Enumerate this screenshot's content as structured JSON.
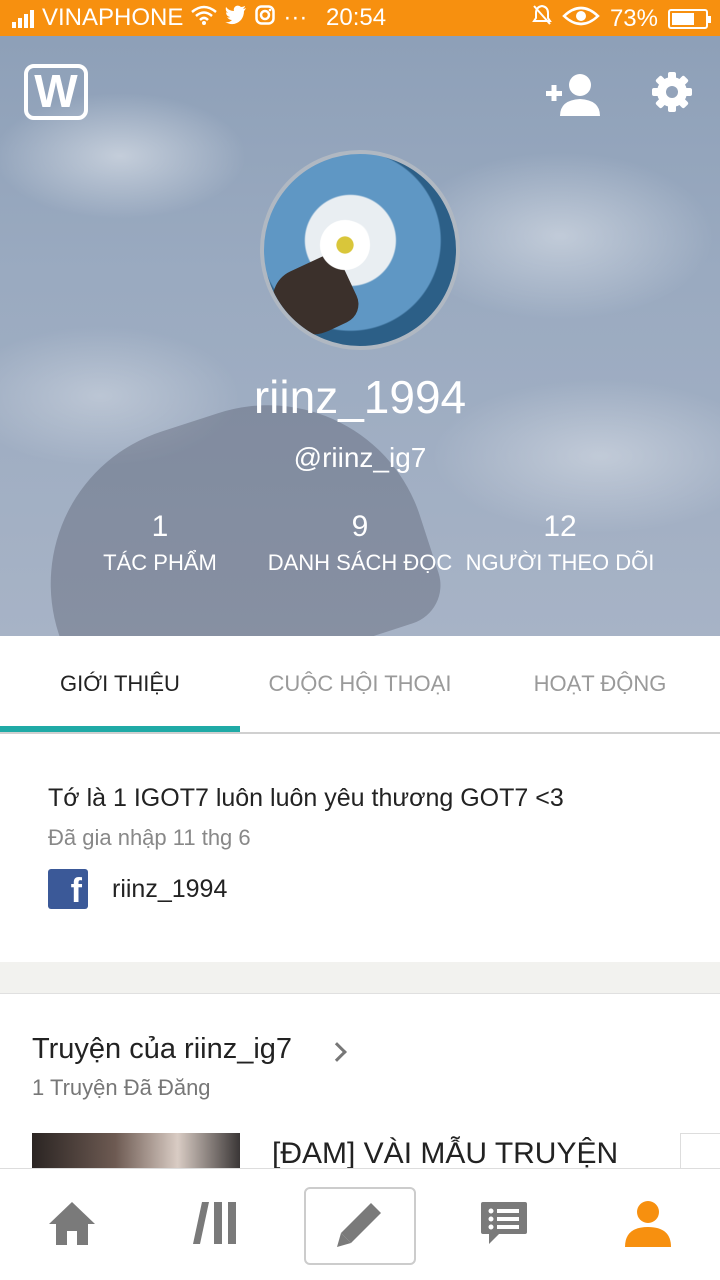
{
  "status_bar": {
    "carrier": "VINAPHONE",
    "time": "20:54",
    "battery": "73%",
    "dots": "···"
  },
  "profile": {
    "display_name": "riinz_1994",
    "handle": "@riinz_ig7",
    "stats": [
      {
        "value": "1",
        "label": "TÁC PHẨM"
      },
      {
        "value": "9",
        "label": "DANH SÁCH ĐỌC"
      },
      {
        "value": "12",
        "label": "NGƯỜI THEO DÕI"
      }
    ]
  },
  "tabs": [
    {
      "label": "GIỚI THIỆU",
      "active": true
    },
    {
      "label": "CUỘC HỘI THOẠI",
      "active": false
    },
    {
      "label": "HOẠT ĐỘNG",
      "active": false
    }
  ],
  "about": {
    "bio": "Tớ là 1 IGOT7 luôn luôn yêu thương GOT7 <3",
    "joined": "Đã gia nhập 11 thg 6",
    "facebook_name": "riinz_1994"
  },
  "stories": {
    "title": "Truyện của riinz_ig7",
    "count_label": "1 Truyện Đã Đăng",
    "items": [
      {
        "title": "[ĐAM] VÀI MẪU TRUYỆN"
      }
    ]
  },
  "bottom_nav": [
    "home-icon",
    "library-icon",
    "pencil-icon",
    "messages-icon",
    "profile-icon"
  ],
  "colors": {
    "status_bar": "#f7900f",
    "tab_indicator": "#1faaa6",
    "nav_icon": "#7a7a7a",
    "nav_active": "#f7900f",
    "facebook": "#3b5998"
  }
}
